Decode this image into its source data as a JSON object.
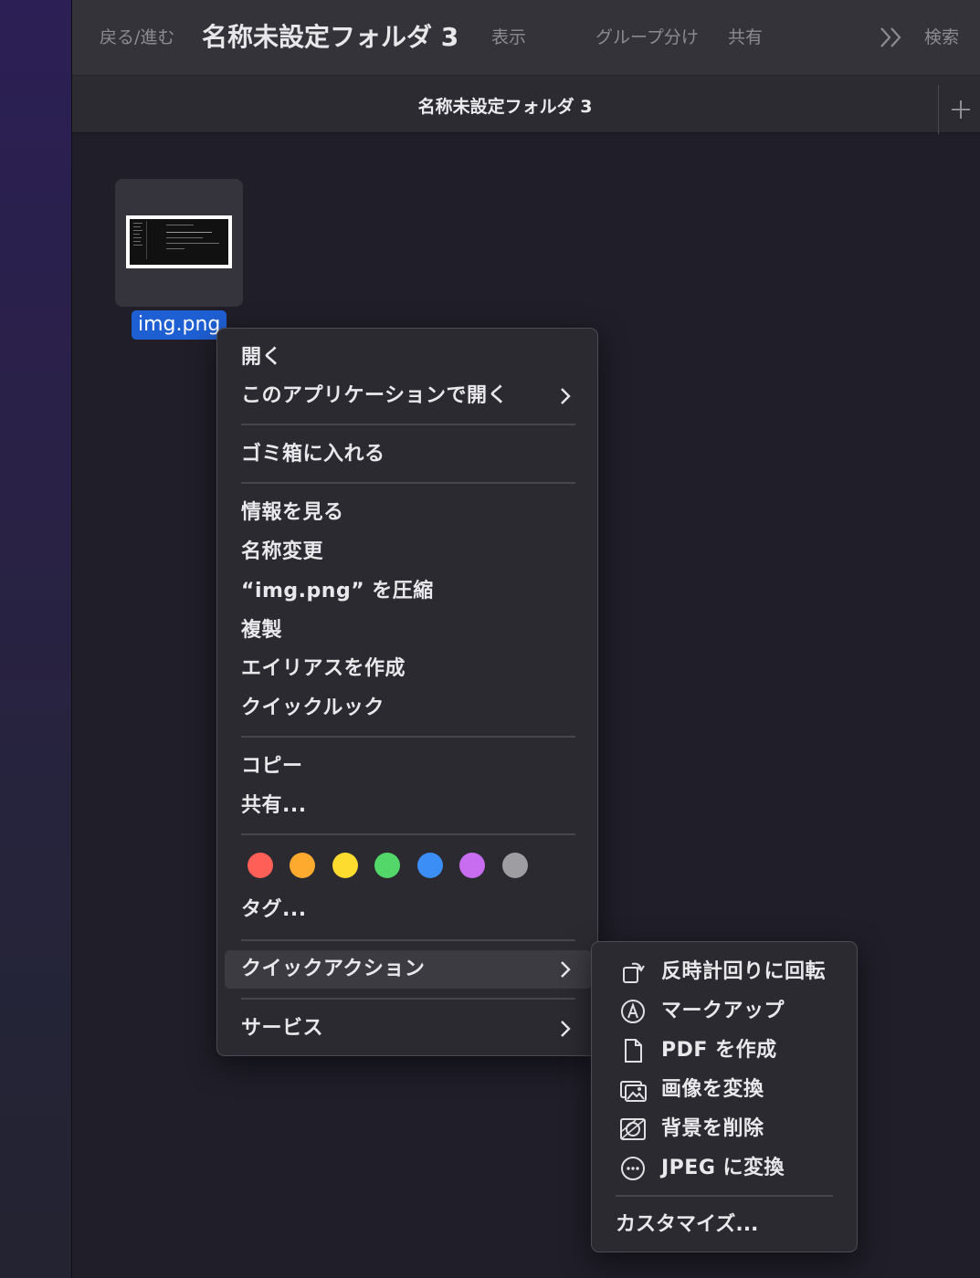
{
  "toolbar": {
    "nav_label": "戻る/進む",
    "title": "名称未設定フォルダ 3",
    "view_label": "表示",
    "group_label": "グループ分け",
    "share_label": "共有",
    "more_icon": "chevron-double-right-icon",
    "search_label": "検索"
  },
  "tabbar": {
    "tab_title": "名称未設定フォルダ 3",
    "new_tab_icon": "plus-icon"
  },
  "file": {
    "name": "img.png",
    "selection_color": "#1e5fd4"
  },
  "context_menu": {
    "items": [
      {
        "label": "開く"
      },
      {
        "label": "このアプリケーションで開く",
        "submenu": true
      },
      {
        "label": "ゴミ箱に入れる"
      },
      {
        "label": "情報を見る"
      },
      {
        "label": "名称変更"
      },
      {
        "label": "“img.png” を圧縮"
      },
      {
        "label": "複製"
      },
      {
        "label": "エイリアスを作成"
      },
      {
        "label": "クイックルック"
      },
      {
        "label": "コピー"
      },
      {
        "label": "共有..."
      },
      {
        "label": "タグ..."
      },
      {
        "label": "クイックアクション",
        "submenu": true,
        "highlighted": true
      },
      {
        "label": "サービス",
        "submenu": true
      }
    ],
    "tag_colors": [
      {
        "name": "red",
        "hex": "#ff5f57"
      },
      {
        "name": "orange",
        "hex": "#fdaa2f"
      },
      {
        "name": "yellow",
        "hex": "#fedb2f"
      },
      {
        "name": "green",
        "hex": "#53d769"
      },
      {
        "name": "blue",
        "hex": "#3a8ef6"
      },
      {
        "name": "purple",
        "hex": "#c86cf0"
      },
      {
        "name": "gray",
        "hex": "#9d9da2"
      }
    ]
  },
  "quick_actions_submenu": {
    "items": [
      {
        "label": "反時計回りに回転",
        "icon": "rotate-left-icon"
      },
      {
        "label": "マークアップ",
        "icon": "markup-icon"
      },
      {
        "label": "PDF を作成",
        "icon": "document-icon"
      },
      {
        "label": "画像を変換",
        "icon": "photo-stack-icon"
      },
      {
        "label": "背景を削除",
        "icon": "remove-background-icon"
      },
      {
        "label": "JPEG に変換",
        "icon": "ellipsis-circle-icon"
      }
    ],
    "customize_label": "カスタマイズ..."
  }
}
